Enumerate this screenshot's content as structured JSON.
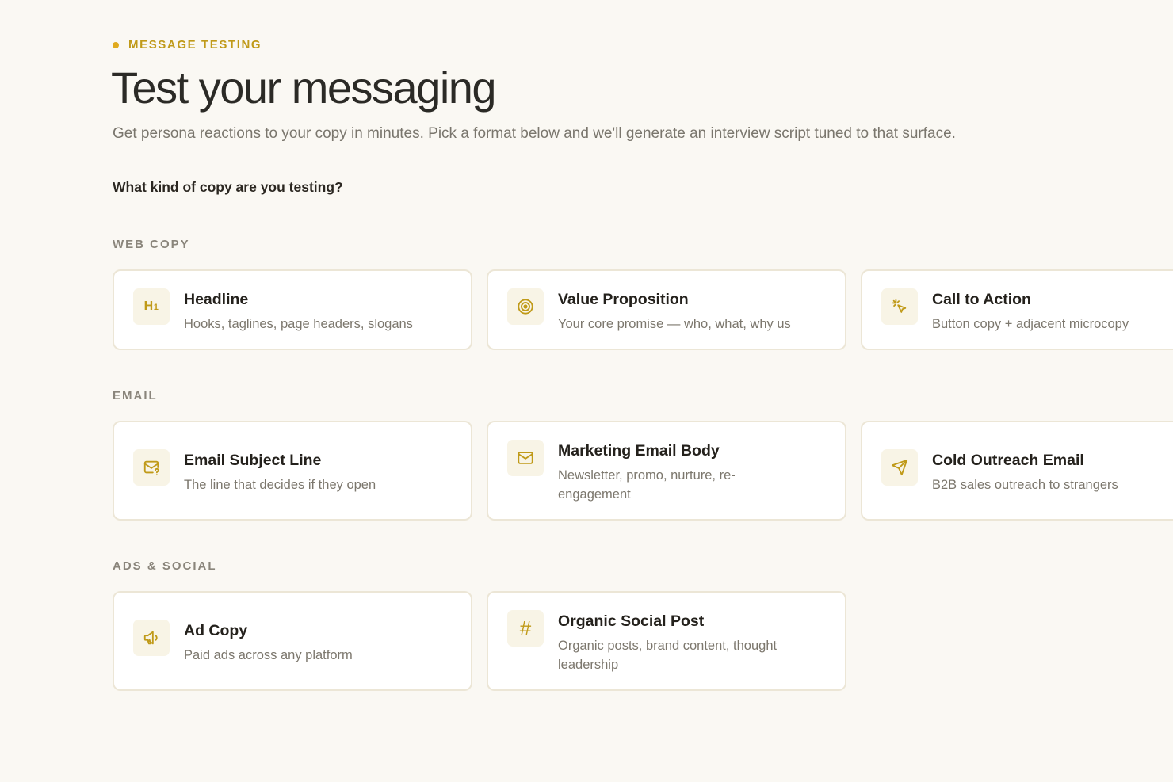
{
  "header": {
    "eyebrow": "MESSAGE TESTING",
    "title": "Test your messaging",
    "subtitle": "Get persona reactions to your copy in minutes. Pick a format below and we'll generate an interview script tuned to that surface.",
    "question": "What kind of copy are you testing?"
  },
  "colors": {
    "accent": "#c09a19",
    "background": "#faf8f3",
    "card_border": "#ece6d6"
  },
  "sections": [
    {
      "label": "WEB COPY",
      "cards": [
        {
          "title": "Headline",
          "description": "Hooks, taglines, page headers, slogans",
          "icon": "heading-icon",
          "icon_text": "H1"
        },
        {
          "title": "Value Proposition",
          "description": "Your core promise — who, what, why us",
          "icon": "target-icon"
        },
        {
          "title": "Call to Action",
          "description": "Button copy + adjacent microcopy",
          "icon": "cursor-click-icon"
        }
      ]
    },
    {
      "label": "EMAIL",
      "cards": [
        {
          "title": "Email Subject Line",
          "description": "The line that decides if they open",
          "icon": "mail-question-icon"
        },
        {
          "title": "Marketing Email Body",
          "description": "Newsletter, promo, nurture, re-engagement",
          "icon": "mail-icon"
        },
        {
          "title": "Cold Outreach Email",
          "description": "B2B sales outreach to strangers",
          "icon": "send-icon"
        }
      ]
    },
    {
      "label": "ADS & SOCIAL",
      "cards": [
        {
          "title": "Ad Copy",
          "description": "Paid ads across any platform",
          "icon": "megaphone-icon"
        },
        {
          "title": "Organic Social Post",
          "description": "Organic posts, brand content, thought leadership",
          "icon": "hash-icon",
          "icon_text": "#"
        }
      ]
    }
  ]
}
